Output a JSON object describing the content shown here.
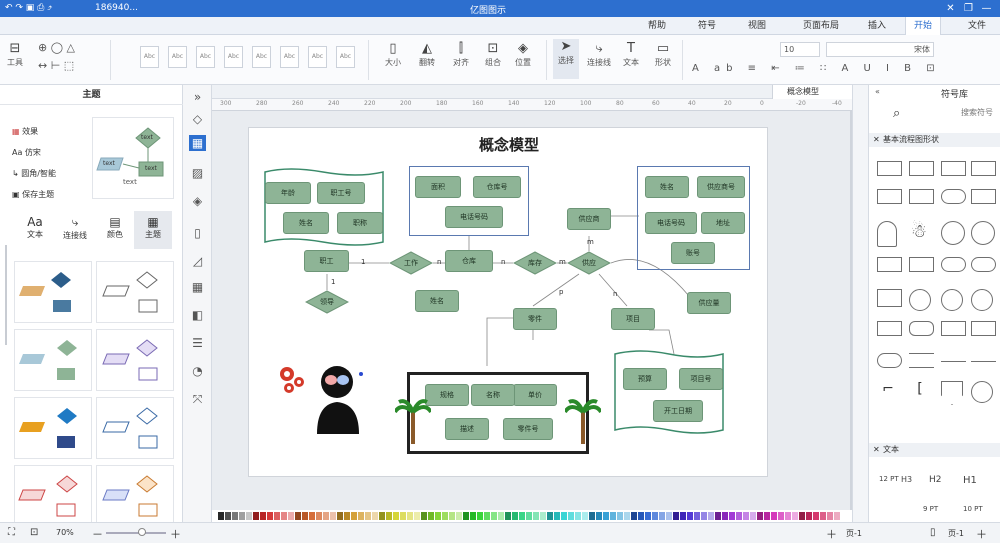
{
  "app": {
    "title": "亿图图示",
    "quick_path": "186940...",
    "window_buttons": [
      "minimize-icon",
      "restore-icon",
      "close-icon"
    ]
  },
  "menu": {
    "items": [
      {
        "label": "文件"
      },
      {
        "label": "开始",
        "active": true
      },
      {
        "label": "插入"
      },
      {
        "label": "页面布局"
      },
      {
        "label": "视图"
      },
      {
        "label": "符号"
      },
      {
        "label": "帮助"
      }
    ]
  },
  "ribbon": {
    "left_tools": [
      {
        "label": "工具"
      }
    ],
    "style_swatch_label": "Abc",
    "style_tools": [
      {
        "label": "位置"
      },
      {
        "label": "组合"
      },
      {
        "label": "对齐"
      },
      {
        "label": "翻转"
      },
      {
        "label": "大小"
      }
    ],
    "main_tools": [
      {
        "label": "选择"
      },
      {
        "label": "连接线"
      },
      {
        "label": "文本"
      },
      {
        "label": "形状"
      }
    ],
    "font": {
      "size": "10",
      "family": "宋体"
    }
  },
  "doc_tab": {
    "label": "概念模型"
  },
  "ruler_ticks": [
    "-40",
    "-20",
    "0",
    "20",
    "40",
    "60",
    "80",
    "100",
    "120",
    "140",
    "160",
    "180",
    "200",
    "220",
    "240",
    "260",
    "280",
    "300"
  ],
  "left_panel": {
    "title": "主题",
    "options": [
      {
        "label": "效果"
      },
      {
        "label": "仿宋"
      },
      {
        "label": "圆角/智能"
      },
      {
        "label": "保存主题"
      }
    ],
    "tabs": [
      {
        "label": "主题"
      },
      {
        "label": "颜色"
      },
      {
        "label": "连接线"
      },
      {
        "label": "文本"
      }
    ],
    "preview_texts": [
      "text",
      "text",
      "text",
      "text"
    ]
  },
  "right_panel": {
    "title": "符号库",
    "search_placeholder": "搜索符号",
    "section1": "基本流程图形状",
    "section2": "文本",
    "text_samples": [
      "H1",
      "H2",
      "H3",
      "12 PT",
      "9 PT",
      "10 PT"
    ]
  },
  "diagram": {
    "title": "概念模型",
    "entities": [
      "职工",
      "仓库",
      "供应商",
      "零件",
      "项目",
      "供应量"
    ],
    "attributes": {
      "worker": [
        "职工号",
        "年龄",
        "职称",
        "姓名"
      ],
      "warehouse": [
        "仓库号",
        "面积",
        "电话号码"
      ],
      "supplier": [
        "供应商号",
        "姓名",
        "电话号码",
        "地址",
        "账号"
      ],
      "part": [
        "单价",
        "名称",
        "规格",
        "零件号",
        "描述"
      ],
      "project": [
        "项目号",
        "预算",
        "开工日期"
      ],
      "other": [
        "姓名"
      ]
    },
    "relations": [
      "工作",
      "领导",
      "库存",
      "供应"
    ],
    "cardinalities": [
      "1",
      "n",
      "n",
      "m",
      "m",
      "p",
      "n",
      "1"
    ]
  },
  "status": {
    "page_label": "页-1",
    "zoom": "70%",
    "page_tab": "页-1"
  },
  "colors": {
    "accent": "#2d6fcf",
    "entity": "#8eb496",
    "frame": "#5a79b0"
  }
}
